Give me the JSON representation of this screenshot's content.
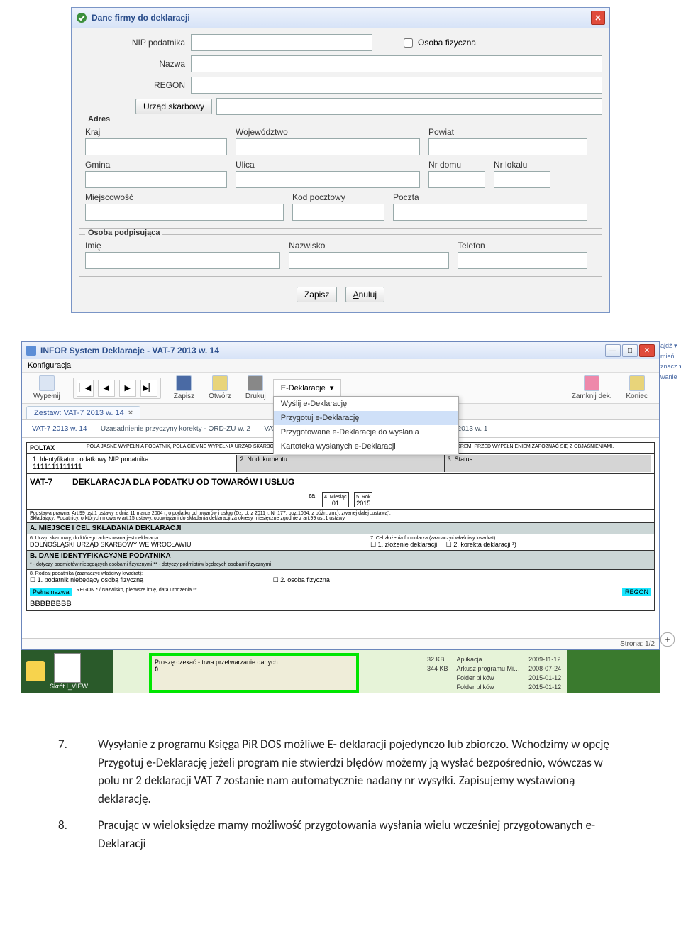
{
  "dialog1": {
    "title": "Dane firmy do deklaracji",
    "fields": {
      "nip_label": "NIP podatnika",
      "osoba_label": "Osoba fizyczna",
      "nazwa_label": "Nazwa",
      "regon_label": "REGON",
      "urzad_btn": "Urząd skarbowy"
    },
    "adres": {
      "legend": "Adres",
      "kraj": "Kraj",
      "woj": "Województwo",
      "powiat": "Powiat",
      "gmina": "Gmina",
      "ulica": "Ulica",
      "nrdomu": "Nr domu",
      "nrlokalu": "Nr lokalu",
      "miejscowosc": "Miejscowość",
      "kod": "Kod pocztowy",
      "poczta": "Poczta"
    },
    "podpis": {
      "legend": "Osoba podpisująca",
      "imie": "Imię",
      "nazwisko": "Nazwisko",
      "telefon": "Telefon"
    },
    "buttons": {
      "save": "Zapisz",
      "cancel": "Anuluj"
    }
  },
  "shot2": {
    "title": "INFOR System Deklaracje - VAT-7 2013 w. 14",
    "menu": "Konfiguracja",
    "toolbar": {
      "wypelnij": "Wypełnij",
      "zapisz": "Zapisz",
      "otworz": "Otwórz",
      "drukuj": "Drukuj",
      "edekl": "E-Deklaracje",
      "zamknij": "Zamknij dek.",
      "koniec": "Koniec"
    },
    "emenu": [
      "Wyślij e-Deklarację",
      "Przygotuj e-Deklarację",
      "Przygotowane e-Deklaracje do wysłania",
      "Kartoteka wysłanych e-Deklaracji"
    ],
    "tab": "Zestaw: VAT-7 2013 w. 14",
    "subtabs": [
      "VAT-7 2013 w. 14",
      "Uzasadnienie przyczyny korekty - ORD-ZU w. 2",
      "VAT-ZT",
      "2013 w. 1"
    ],
    "side": [
      "ajdź ▾",
      "mień",
      "znacz ▾",
      "wanie"
    ],
    "form": {
      "poltax": "POLTAX",
      "note": "POLA JASNE WYPEŁNIA PODATNIK, POLA CIEMNE WYPEŁNIA URZĄD SKARBOWY. WYPEŁNIAĆ DRUKOWANYMI LITERAMI, CZARNYM LUB NIEBIESKIM KOLOREM. PRZED WYPEŁNIENIEM ZAPOZNAĆ SIĘ Z OBJAŚNIENIAMI.",
      "f1_label": "1. Identyfikator podatkowy NIP podatnika",
      "f1_val": "1111111111111",
      "f2_label": "2. Nr dokumentu",
      "f3_label": "3. Status",
      "vat7": "VAT-7",
      "heading": "DEKLARACJA DLA PODATKU OD TOWARÓW I USŁUG",
      "za": "za",
      "f4_label": "4. Miesiąc",
      "f4_val": "01",
      "f5_label": "5. Rok",
      "f5_val": "2015",
      "podstawa": "Podstawa prawna:   Art.99 ust.1 ustawy z dnia 11 marca 2004 r. o podatku od towarów i usług (Dz. U. z 2011 r. Nr 177, poz.1054, z późn. zm.), zwanej dalej „ustawą\".",
      "skladajacy": "Składający:   Podatnicy, o których mowa w art.15 ustawy, obowiązani do składania deklaracji za okresy miesięczne zgodnie z art.99 ust.1 ustawy.",
      "secA": "A. MIEJSCE I CEL SKŁADANIA DEKLARACJI",
      "f6_label": "6. Urząd skarbowy, do którego adresowana jest deklaracja",
      "f6_val": "DOLNOŚLĄSKI URZĄD SKARBOWY WE WROCŁAWIU",
      "f7_label": "7. Cel złożenia formularza (zaznaczyć właściwy kwadrat):",
      "f7_opt1": "1. złożenie deklaracji",
      "f7_opt2": "2. korekta deklaracji ¹)",
      "secB": "B. DANE IDENTYFIKACYJNE PODATNIKA",
      "secB_sub": "* - dotyczy podmiotów niebędących osobami fizycznymi        ** - dotyczy podmiotów będących osobami fizycznymi",
      "f8_label": "8. Rodzaj podatnika (zaznaczyć właściwy kwadrat):",
      "f8_opt1": "1. podatnik niebędący osobą fizyczną",
      "f8_opt2": "2. osoba fizyczna",
      "pelna": "Pełna nazwa",
      "regon_note": "REGON * / Nazwisko, pierwsze imię, data urodzenia **",
      "regon_hl": "REGON",
      "bbb": "BBBBBBBB"
    },
    "status": "Strona: 1/2",
    "desk": {
      "folder": "Skrót I_VIEW",
      "processing": "Proszę czekać - trwa przetwarzanie danych",
      "zero": "0",
      "files": [
        [
          "32 KB",
          "Aplikacja",
          "2009-11-12"
        ],
        [
          "344 KB",
          "Arkusz programu Mi…",
          "2008-07-24"
        ],
        [
          "",
          "Folder plików",
          "2015-01-12"
        ],
        [
          "",
          "Folder plików",
          "2015-01-12"
        ]
      ]
    }
  },
  "para7_num": "7.",
  "para7": "Wysyłanie z programu Księga PiR DOS możliwe E- deklaracji  pojedynczo lub zbiorczo. Wchodzimy w opcję Przygotuj e-Deklarację jeżeli program nie stwierdzi błędów możemy ją wysłać  bezpośrednio, wówczas w polu nr 2 deklaracji VAT 7 zostanie nam automatycznie nadany nr wysyłki.   Zapisujemy wystawioną deklarację.",
  "para8_num": "8.",
  "para8": "Pracując w wieloksiędze  mamy możliwość  przygotowania wysłania wielu wcześniej przygotowanych e-Deklaracji"
}
